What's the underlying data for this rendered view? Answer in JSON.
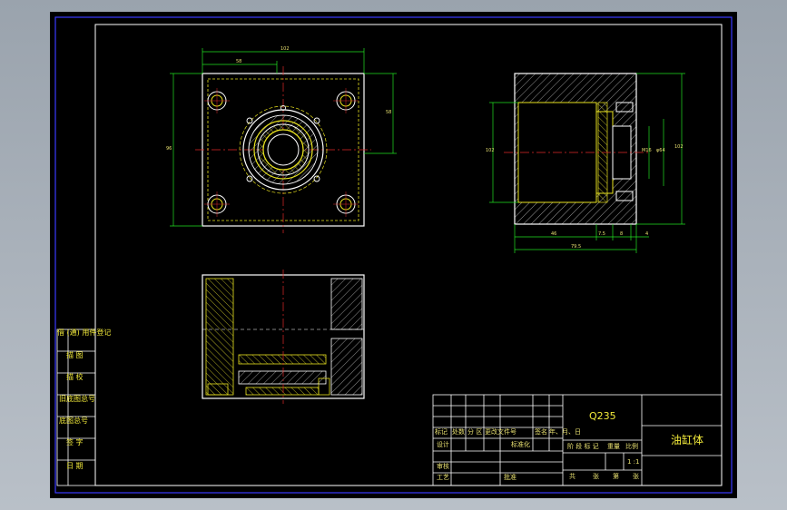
{
  "title_block": {
    "material": "Q235",
    "part_name": "油缸体",
    "header_row": [
      "标记",
      "处数",
      "分 区",
      "更改文件号",
      "签名",
      "年、月、日"
    ],
    "sign_row_left": "设计",
    "standardization": "标准化",
    "stage_headers": [
      "阶 段 标 记",
      "重量",
      "比例"
    ],
    "scale": "1 :1",
    "review": "审核",
    "process": "工艺",
    "approve": "批准",
    "sheet_total": "共",
    "sheet_label": "张",
    "sheet_no": "第",
    "sheet_label2": "张"
  },
  "side_table": {
    "rows": [
      "借 (通) 用件登记",
      "描 图",
      "描 校",
      "旧底图总号",
      "底图总号",
      "签 字",
      "日 期"
    ]
  },
  "dimensions": {
    "top_overall": "102",
    "top_partial": "58",
    "left_height": "96",
    "right_height": "58",
    "side_bottom_a": "46",
    "side_bottom_b": "7.5",
    "side_bottom_c": "8",
    "side_bottom_d": "4",
    "side_overall": "79.5",
    "side_left": "102",
    "side_right": "102",
    "side_inner_a": "M16",
    "side_inner_b": "φ64"
  },
  "colors": {
    "outline": "#ffffff",
    "geometry": "#e8e21e",
    "dimension": "#22e022",
    "centerline": "#e02828",
    "hatch": "#c8c8c8",
    "frame_blue": "#3434ff"
  }
}
